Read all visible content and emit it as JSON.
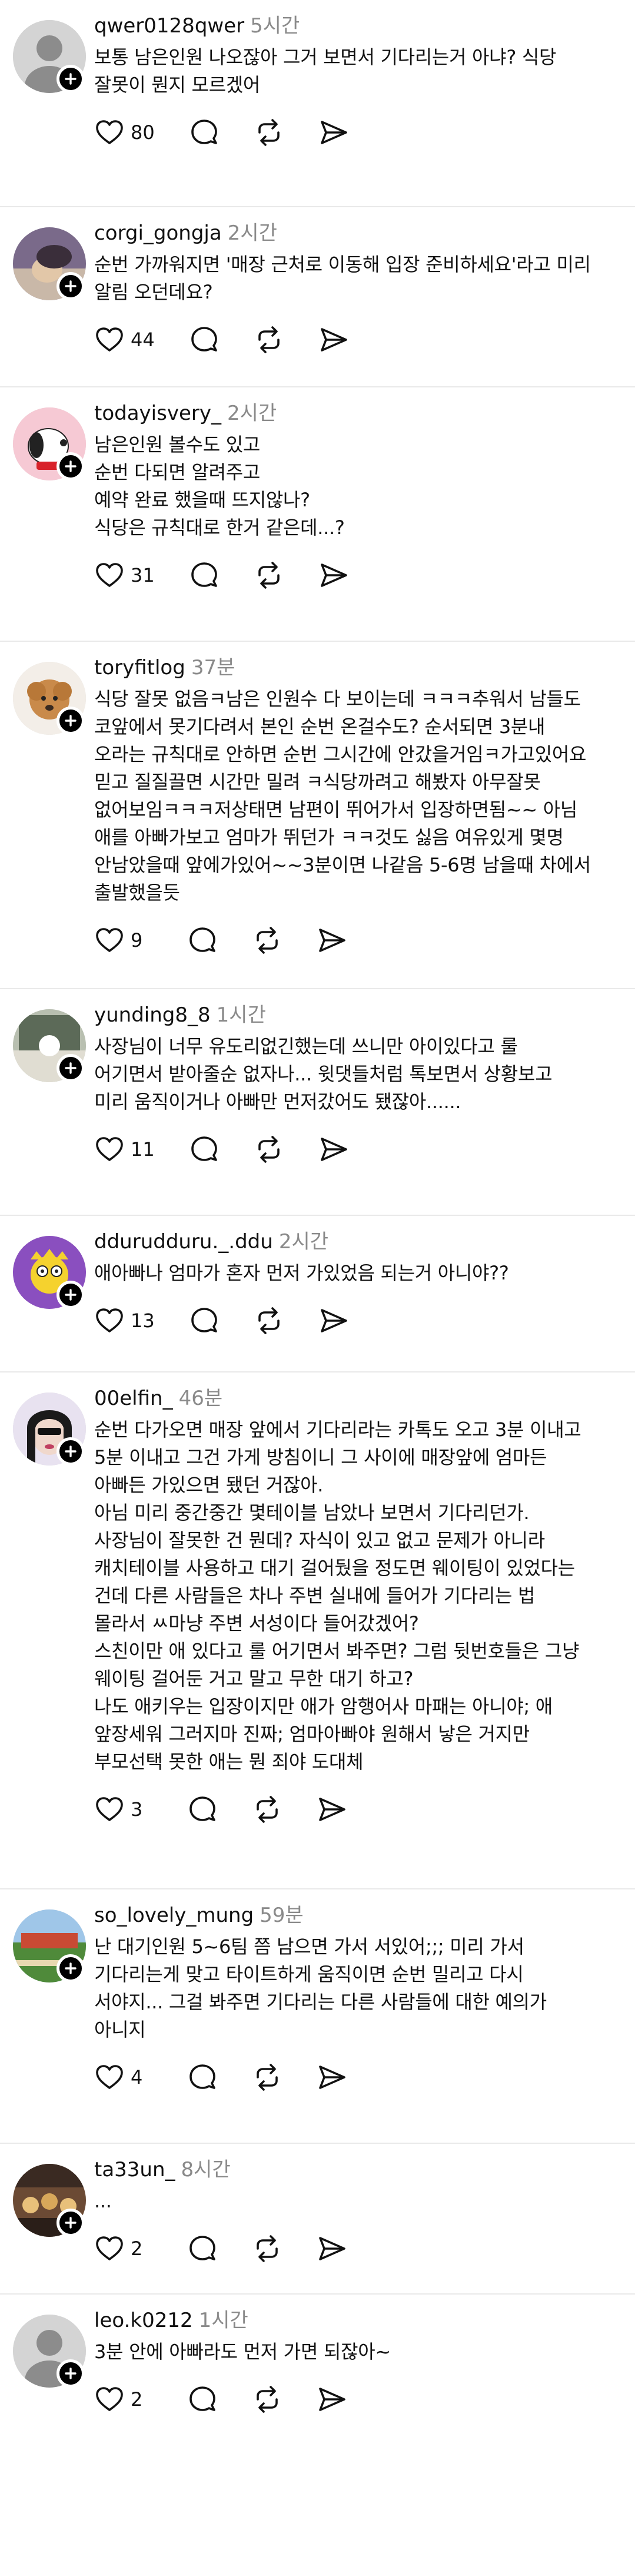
{
  "colors": {
    "text": "#111111",
    "muted": "#8a8a8a",
    "divider": "#e9e9e9",
    "badge": "#000000"
  },
  "posts": [
    {
      "username": "qwer0128qwer",
      "time": "5시간",
      "text": "보통 남은인원 나오잖아 그거 보면서 기다리는거 아냐? 식당\n잘못이 뭔지 모르겠어",
      "likes": "80",
      "avatar": "default-avatar"
    },
    {
      "username": "corgi_gongja",
      "time": "2시간",
      "text": "순번 가까워지면 '매장 근처로 이동해 입장 준비하세요'라고 미리\n알림 오던데요?",
      "likes": "44",
      "avatar": "photo-avatar"
    },
    {
      "username": "todayisvery_",
      "time": "2시간",
      "text": "남은인원 볼수도 있고\n순번 다되면 알려주고\n예약 완료 했을때 뜨지않나?\n식당은 규칙대로 한거 같은데...?",
      "likes": "31",
      "avatar": "snoopy-avatar"
    },
    {
      "username": "toryfitlog",
      "time": "37분",
      "text": "식당 잘못 없음ㅋ남은 인원수 다 보이는데 ㅋㅋㅋ추워서 남들도\n코앞에서 못기다려서 본인 순번 온걸수도? 순서되면 3분내\n오라는 규칙대로 안하면 순번 그시간에 안갔을거임ㅋ가고있어요\n믿고 질질끌면 시간만 밀려 ㅋ식당까려고 해봤자 아무잘못\n없어보임ㅋㅋㅋ저상태면 남편이 뛰어가서 입장하면됨~~ 아님\n애를 아빠가보고 엄마가 뛰던가 ㅋㅋ것도 싫음 여유있게 몇명\n안남았을때 앞에가있어~~3분이면 나같음 5-6명 남을때 차에서\n출발했을듯",
      "likes": "9",
      "avatar": "poodle-avatar"
    },
    {
      "username": "yunding8_8",
      "time": "1시간",
      "text": "사장님이 너무 유도리없긴했는데 쓰니만 아이있다고 룰\n어기면서 받아줄순 없자나... 윗댓들처럼 톡보면서 상황보고\n미리 움직이거나 아빠만 먼저갔어도 됐잖아......",
      "likes": "11",
      "avatar": "photo-avatar"
    },
    {
      "username": "ddurudduru._.ddu",
      "time": "2시간",
      "text": "애아빠나 엄마가 혼자 먼저 가있었음 되는거 아니야??",
      "likes": "13",
      "avatar": "cartoon-avatar"
    },
    {
      "username": "00elfin_",
      "time": "46분",
      "text": "순번 다가오면 매장 앞에서 기다리라는 카톡도 오고 3분 이내고\n5분 이내고 그건 가게 방침이니 그 사이에 매장앞에 엄마든\n아빠든 가있으면 됐던 거잖아.\n아님 미리 중간중간 몇테이블 남았나 보면서 기다리던가.\n사장님이 잘못한 건 뭔데? 자식이 있고 없고 문제가 아니라\n캐치테이블 사용하고 대기 걸어뒀을 정도면 웨이팅이 있었다는\n건데 다른 사람들은 차나 주변 실내에 들어가 기다리는 법\n몰라서 ㅆ마냥 주변 서성이다 들어갔겠어?\n스친이만 애 있다고 룰 어기면서 봐주면? 그럼 뒷번호들은 그냥\n웨이팅 걸어둔 거고 말고 무한 대기 하고?\n나도 애키우는 입장이지만 애가 암행어사 마패는 아니야; 애\n앞장세워 그러지마 진짜; 엄마아빠야 원해서 낳은 거지만\n부모선택 못한 애는 뭔 죄야 도대체",
      "likes": "3",
      "avatar": "photo-avatar"
    },
    {
      "username": "so_lovely_mung",
      "time": "59분",
      "text": "난 대기인원 5~6팀 쯤 남으면 가서 서있어;;; 미리 가서\n기다리는게 맞고 타이트하게 움직이면 순번 밀리고 다시\n서야지... 그걸 봐주면 기다리는 다른 사람들에 대한 예의가\n아니지",
      "likes": "4",
      "avatar": "photo-avatar"
    },
    {
      "username": "ta33un_",
      "time": "8시간",
      "text": "...",
      "likes": "2",
      "avatar": "photo-avatar"
    },
    {
      "username": "leo.k0212",
      "time": "1시간",
      "text": "3분 안에 아빠라도 먼저 가면 되잖아~",
      "likes": "2",
      "avatar": "default-avatar"
    }
  ]
}
